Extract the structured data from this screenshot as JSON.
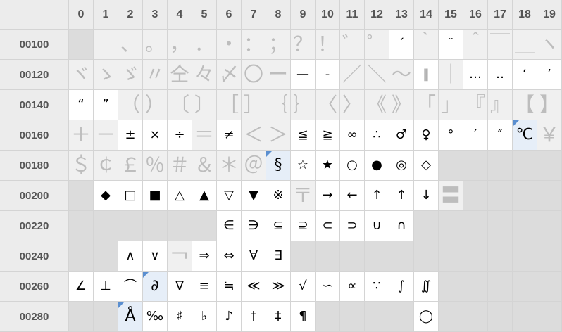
{
  "columns": [
    "0",
    "1",
    "2",
    "3",
    "4",
    "5",
    "6",
    "7",
    "8",
    "9",
    "10",
    "11",
    "12",
    "13",
    "14",
    "15",
    "16",
    "17",
    "18",
    "19"
  ],
  "rows": [
    {
      "label": "00100",
      "cells": [
        {
          "t": "e"
        },
        {
          "t": "f",
          "g": ""
        },
        {
          "t": "f",
          "g": "、"
        },
        {
          "t": "f",
          "g": "。"
        },
        {
          "t": "f",
          "g": "，"
        },
        {
          "t": "f",
          "g": "．"
        },
        {
          "t": "f",
          "g": "・"
        },
        {
          "t": "f",
          "g": "："
        },
        {
          "t": "f",
          "g": "；"
        },
        {
          "t": "f",
          "g": "？"
        },
        {
          "t": "f",
          "g": "！"
        },
        {
          "t": "f",
          "g": "゛"
        },
        {
          "t": "f",
          "g": "゜"
        },
        {
          "t": "d",
          "g": "´"
        },
        {
          "t": "f",
          "g": "｀"
        },
        {
          "t": "d",
          "g": "¨"
        },
        {
          "t": "f",
          "g": "＾"
        },
        {
          "t": "f",
          "g": "￣"
        },
        {
          "t": "f",
          "g": "＿"
        },
        {
          "t": "f",
          "g": "ヽ"
        }
      ]
    },
    {
      "label": "00120",
      "cells": [
        {
          "t": "f",
          "g": "ヾ"
        },
        {
          "t": "f",
          "g": "ゝ"
        },
        {
          "t": "f",
          "g": "ゞ"
        },
        {
          "t": "f",
          "g": "〃"
        },
        {
          "t": "f",
          "g": "仝"
        },
        {
          "t": "f",
          "g": "々"
        },
        {
          "t": "f",
          "g": "〆"
        },
        {
          "t": "f",
          "g": "〇"
        },
        {
          "t": "f",
          "g": "ー"
        },
        {
          "t": "d",
          "g": "—"
        },
        {
          "t": "d",
          "g": "‐"
        },
        {
          "t": "f",
          "g": "／"
        },
        {
          "t": "f",
          "g": "＼"
        },
        {
          "t": "f",
          "g": "～"
        },
        {
          "t": "d",
          "g": "‖"
        },
        {
          "t": "f",
          "g": "｜"
        },
        {
          "t": "d",
          "g": "…"
        },
        {
          "t": "d",
          "g": "‥"
        },
        {
          "t": "d",
          "g": "‘"
        },
        {
          "t": "d",
          "g": "’"
        }
      ]
    },
    {
      "label": "00140",
      "cells": [
        {
          "t": "d",
          "g": "“"
        },
        {
          "t": "d",
          "g": "”"
        },
        {
          "t": "f",
          "g": "（"
        },
        {
          "t": "f",
          "g": "）"
        },
        {
          "t": "f",
          "g": "〔"
        },
        {
          "t": "f",
          "g": "〕"
        },
        {
          "t": "f",
          "g": "［"
        },
        {
          "t": "f",
          "g": "］"
        },
        {
          "t": "f",
          "g": "｛"
        },
        {
          "t": "f",
          "g": "｝"
        },
        {
          "t": "f",
          "g": "〈"
        },
        {
          "t": "f",
          "g": "〉"
        },
        {
          "t": "f",
          "g": "《"
        },
        {
          "t": "f",
          "g": "》"
        },
        {
          "t": "f",
          "g": "「"
        },
        {
          "t": "f",
          "g": "」"
        },
        {
          "t": "f",
          "g": "『"
        },
        {
          "t": "f",
          "g": "』"
        },
        {
          "t": "f",
          "g": "【"
        },
        {
          "t": "f",
          "g": "】"
        }
      ]
    },
    {
      "label": "00160",
      "cells": [
        {
          "t": "f",
          "g": "＋"
        },
        {
          "t": "f",
          "g": "－"
        },
        {
          "t": "d",
          "g": "±"
        },
        {
          "t": "d",
          "g": "×"
        },
        {
          "t": "d",
          "g": "÷"
        },
        {
          "t": "f",
          "g": "＝"
        },
        {
          "t": "d",
          "g": "≠"
        },
        {
          "t": "f",
          "g": "＜"
        },
        {
          "t": "f",
          "g": "＞"
        },
        {
          "t": "d",
          "g": "≦"
        },
        {
          "t": "d",
          "g": "≧"
        },
        {
          "t": "d",
          "g": "∞"
        },
        {
          "t": "d",
          "g": "∴"
        },
        {
          "t": "d",
          "g": "♂"
        },
        {
          "t": "d",
          "g": "♀"
        },
        {
          "t": "d",
          "g": "°"
        },
        {
          "t": "d",
          "g": "′"
        },
        {
          "t": "d",
          "g": "″"
        },
        {
          "t": "s",
          "g": "℃"
        },
        {
          "t": "f",
          "g": "￥"
        }
      ]
    },
    {
      "label": "00180",
      "cells": [
        {
          "t": "f",
          "g": "＄"
        },
        {
          "t": "f",
          "g": "￠"
        },
        {
          "t": "f",
          "g": "￡"
        },
        {
          "t": "f",
          "g": "％"
        },
        {
          "t": "f",
          "g": "＃"
        },
        {
          "t": "f",
          "g": "＆"
        },
        {
          "t": "f",
          "g": "＊"
        },
        {
          "t": "f",
          "g": "＠"
        },
        {
          "t": "s",
          "g": "§"
        },
        {
          "t": "d",
          "g": "☆"
        },
        {
          "t": "d",
          "g": "★"
        },
        {
          "t": "d",
          "g": "○"
        },
        {
          "t": "d",
          "g": "●"
        },
        {
          "t": "d",
          "g": "◎"
        },
        {
          "t": "d",
          "g": "◇"
        },
        {
          "t": "e"
        },
        {
          "t": "e"
        },
        {
          "t": "e"
        },
        {
          "t": "e"
        },
        {
          "t": "e"
        }
      ]
    },
    {
      "label": "00200",
      "cells": [
        {
          "t": "e"
        },
        {
          "t": "d",
          "g": "◆"
        },
        {
          "t": "d",
          "g": "□"
        },
        {
          "t": "d",
          "g": "■"
        },
        {
          "t": "d",
          "g": "△"
        },
        {
          "t": "d",
          "g": "▲"
        },
        {
          "t": "d",
          "g": "▽"
        },
        {
          "t": "d",
          "g": "▼"
        },
        {
          "t": "d",
          "g": "※"
        },
        {
          "t": "f",
          "g": "〒"
        },
        {
          "t": "d",
          "g": "→"
        },
        {
          "t": "d",
          "g": "←"
        },
        {
          "t": "d",
          "g": "↑"
        },
        {
          "t": "d",
          "g": "↑"
        },
        {
          "t": "d",
          "g": "↓"
        },
        {
          "t": "f",
          "g": "〓"
        },
        {
          "t": "e"
        },
        {
          "t": "e"
        },
        {
          "t": "e"
        },
        {
          "t": "e"
        }
      ]
    },
    {
      "label": "00220",
      "cells": [
        {
          "t": "e"
        },
        {
          "t": "e"
        },
        {
          "t": "e"
        },
        {
          "t": "e"
        },
        {
          "t": "e"
        },
        {
          "t": "e"
        },
        {
          "t": "d",
          "g": "∈"
        },
        {
          "t": "d",
          "g": "∋"
        },
        {
          "t": "d",
          "g": "⊆"
        },
        {
          "t": "d",
          "g": "⊇"
        },
        {
          "t": "d",
          "g": "⊂"
        },
        {
          "t": "d",
          "g": "⊃"
        },
        {
          "t": "d",
          "g": "∪"
        },
        {
          "t": "d",
          "g": "∩"
        },
        {
          "t": "e"
        },
        {
          "t": "e"
        },
        {
          "t": "e"
        },
        {
          "t": "e"
        },
        {
          "t": "e"
        },
        {
          "t": "e"
        }
      ]
    },
    {
      "label": "00240",
      "cells": [
        {
          "t": "e"
        },
        {
          "t": "e"
        },
        {
          "t": "d",
          "g": "∧"
        },
        {
          "t": "d",
          "g": "∨"
        },
        {
          "t": "f",
          "g": "￢"
        },
        {
          "t": "d",
          "g": "⇒"
        },
        {
          "t": "d",
          "g": "⇔"
        },
        {
          "t": "d",
          "g": "∀"
        },
        {
          "t": "d",
          "g": "∃"
        },
        {
          "t": "e"
        },
        {
          "t": "e"
        },
        {
          "t": "e"
        },
        {
          "t": "e"
        },
        {
          "t": "e"
        },
        {
          "t": "e"
        },
        {
          "t": "e"
        },
        {
          "t": "e"
        },
        {
          "t": "e"
        },
        {
          "t": "e"
        },
        {
          "t": "e"
        }
      ]
    },
    {
      "label": "00260",
      "cells": [
        {
          "t": "d",
          "g": "∠"
        },
        {
          "t": "d",
          "g": "⊥"
        },
        {
          "t": "d",
          "g": "⌒"
        },
        {
          "t": "s",
          "g": "∂"
        },
        {
          "t": "d",
          "g": "∇"
        },
        {
          "t": "d",
          "g": "≡"
        },
        {
          "t": "d",
          "g": "≒"
        },
        {
          "t": "d",
          "g": "≪"
        },
        {
          "t": "d",
          "g": "≫"
        },
        {
          "t": "d",
          "g": "√"
        },
        {
          "t": "d",
          "g": "∽"
        },
        {
          "t": "d",
          "g": "∝"
        },
        {
          "t": "d",
          "g": "∵"
        },
        {
          "t": "d",
          "g": "∫"
        },
        {
          "t": "d",
          "g": "∬"
        },
        {
          "t": "e"
        },
        {
          "t": "e"
        },
        {
          "t": "e"
        },
        {
          "t": "e"
        },
        {
          "t": "e"
        }
      ]
    },
    {
      "label": "00280",
      "cells": [
        {
          "t": "e"
        },
        {
          "t": "e"
        },
        {
          "t": "s",
          "g": "Å"
        },
        {
          "t": "d",
          "g": "‰"
        },
        {
          "t": "d",
          "g": "♯"
        },
        {
          "t": "d",
          "g": "♭"
        },
        {
          "t": "d",
          "g": "♪"
        },
        {
          "t": "d",
          "g": "†"
        },
        {
          "t": "d",
          "g": "‡"
        },
        {
          "t": "d",
          "g": "¶"
        },
        {
          "t": "e"
        },
        {
          "t": "e"
        },
        {
          "t": "e"
        },
        {
          "t": "e"
        },
        {
          "t": "d",
          "g": "◯"
        },
        {
          "t": "e"
        },
        {
          "t": "e"
        },
        {
          "t": "e"
        },
        {
          "t": "e"
        },
        {
          "t": "e"
        }
      ]
    }
  ]
}
